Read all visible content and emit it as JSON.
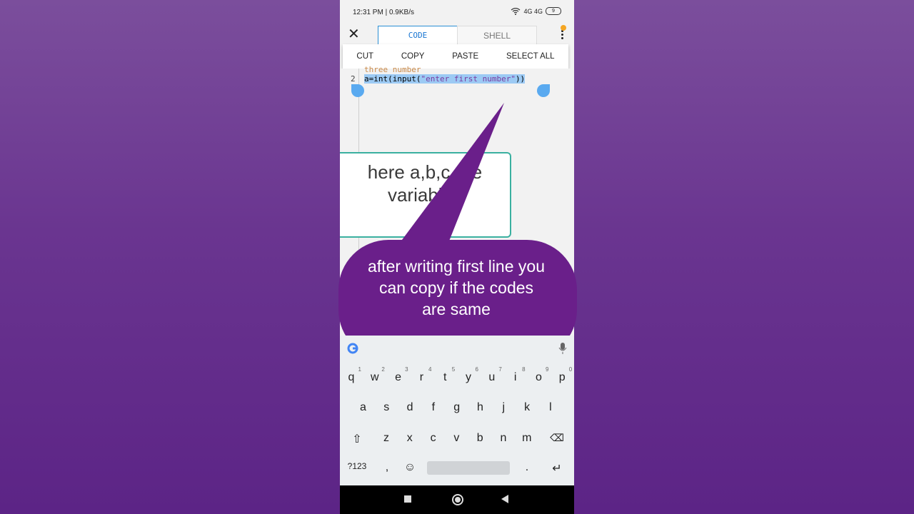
{
  "status_bar": {
    "time": "12:31 PM | 0.9KB/s",
    "network": "4G  4G",
    "battery": "9"
  },
  "toolbar": {
    "tab_code": "CODE",
    "tab_shell": "SHELL"
  },
  "context_menu": {
    "cut": "CUT",
    "copy": "COPY",
    "paste": "PASTE",
    "select_all": "SELECT ALL"
  },
  "editor": {
    "line1_partial": "three number",
    "line2_number": "2",
    "line2_code_prefix": "a=int(input(",
    "line2_string": "\"enter first number\"",
    "line2_code_suffix": "))"
  },
  "callout_box": {
    "text": "here  a,b,c are variables"
  },
  "speech_bubble": {
    "text": "after writing first line you can copy if the codes are same"
  },
  "keyboard": {
    "row1": [
      "q",
      "w",
      "e",
      "r",
      "t",
      "y",
      "u",
      "i",
      "o",
      "p"
    ],
    "row1_hints": [
      "1",
      "2",
      "3",
      "4",
      "5",
      "6",
      "7",
      "8",
      "9",
      "0"
    ],
    "row2": [
      "a",
      "s",
      "d",
      "f",
      "g",
      "h",
      "j",
      "k",
      "l"
    ],
    "row3": [
      "z",
      "x",
      "c",
      "v",
      "b",
      "n",
      "m"
    ],
    "symbols_key": "?123",
    "comma_key": ",",
    "period_key": "."
  },
  "colors": {
    "accent": "#1976d2",
    "bubble": "#6a1f8a",
    "selection": "#9ccaf4",
    "handle": "#5aaaf0"
  }
}
